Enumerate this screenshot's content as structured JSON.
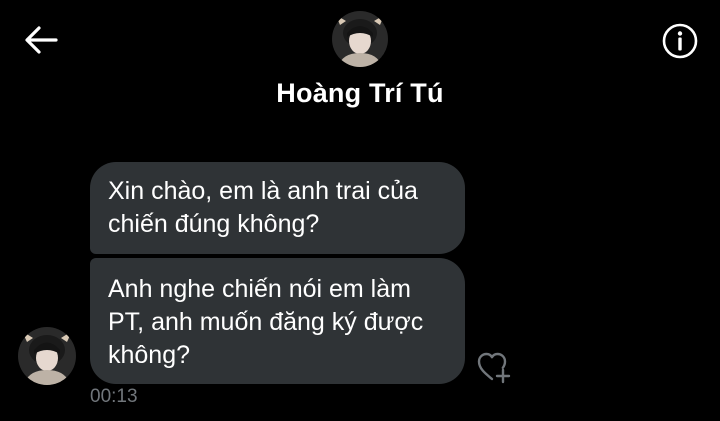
{
  "header": {
    "contact_name": "Hoàng Trí Tú"
  },
  "icons": {
    "back": "arrow-left-icon",
    "info": "info-circle-icon",
    "react": "heart-plus-icon"
  },
  "messages": [
    {
      "sender": "Hoàng Trí Tú",
      "text": "Xin chào, em là anh trai của chiến đúng không?"
    },
    {
      "sender": "Hoàng Trí Tú",
      "text": "Anh nghe chiến nói em làm PT, anh muốn đăng ký được không?"
    }
  ],
  "last_message_time": "00:13",
  "colors": {
    "background": "#000000",
    "bubble": "#2f3336",
    "text": "#ffffff",
    "muted": "#71767b"
  }
}
